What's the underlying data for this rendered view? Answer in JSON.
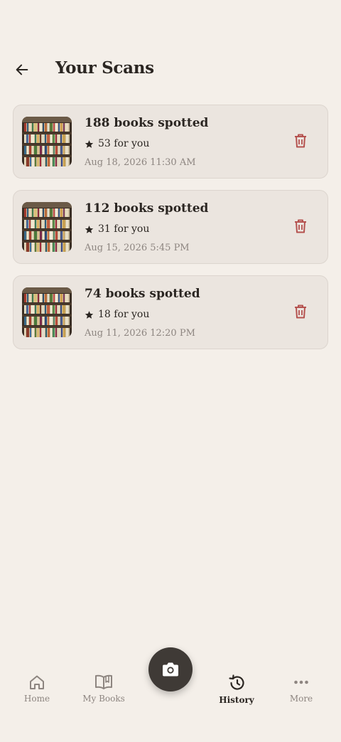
{
  "header": {
    "title": "Your Scans"
  },
  "scans": [
    {
      "title": "188 books spotted",
      "match": "53 for you",
      "date": "Aug 18, 2026 11:30 AM"
    },
    {
      "title": "112 books spotted",
      "match": "31 for you",
      "date": "Aug 15, 2026 5:45 PM"
    },
    {
      "title": "74 books spotted",
      "match": "18 for you",
      "date": "Aug 11, 2026 12:20 PM"
    }
  ],
  "nav": {
    "home": "Home",
    "my_books": "My Books",
    "history": "History",
    "more": "More",
    "active": "History"
  },
  "colors": {
    "background": "#f4efe9",
    "card": "#ebe5df",
    "delete": "#b5524f",
    "fab": "#3f3a36",
    "text": "#2b2622",
    "muted": "#8d8580"
  },
  "icons": {
    "back": "arrow-left-icon",
    "match": "star-icon",
    "delete": "trash-icon",
    "camera": "camera-icon",
    "home": "home-icon",
    "my_books": "open-book-icon",
    "history": "history-icon",
    "more": "more-dots-icon"
  }
}
